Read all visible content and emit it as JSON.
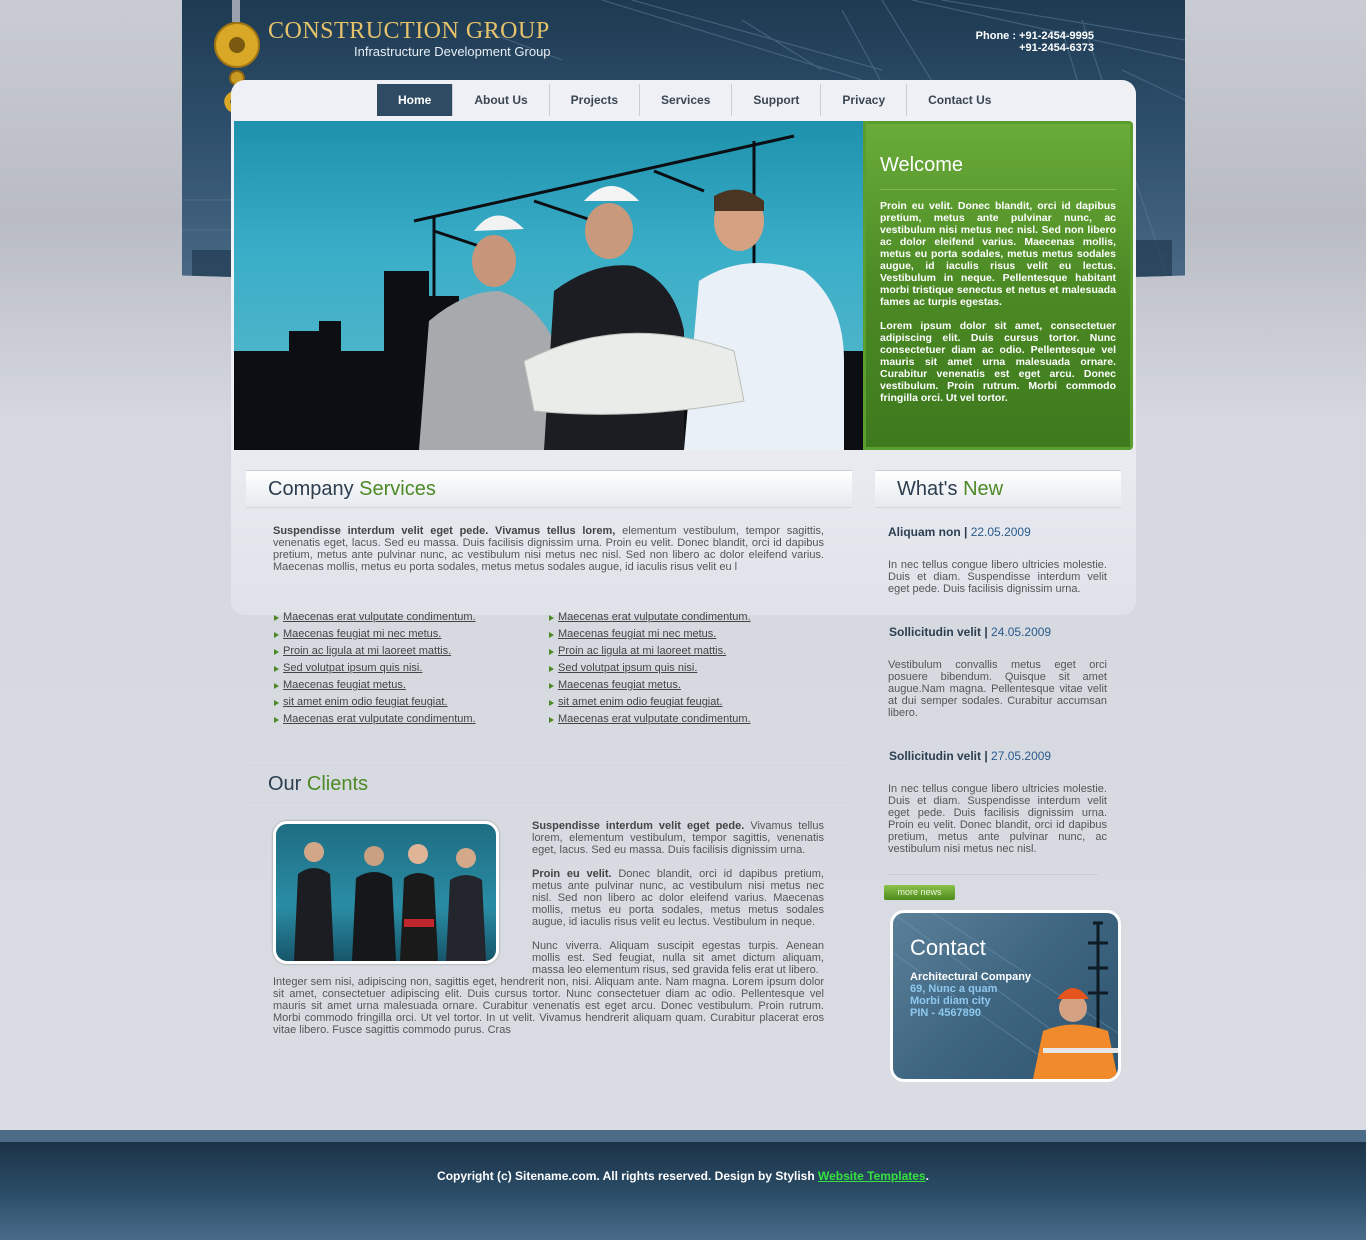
{
  "brand": {
    "title": "CONSTRUCTION GROUP",
    "subtitle": "Infrastructure Development Group"
  },
  "phone": {
    "line1": "Phone : +91-2454-9995",
    "line2": "+91-2454-6373"
  },
  "nav": {
    "items": [
      {
        "label": "Home",
        "active": true
      },
      {
        "label": "About Us"
      },
      {
        "label": "Projects"
      },
      {
        "label": "Services"
      },
      {
        "label": "Support"
      },
      {
        "label": "Privacy"
      },
      {
        "label": "Contact Us"
      }
    ]
  },
  "welcome": {
    "title": "Welcome",
    "p1": "Proin eu velit. Donec blandit, orci id dapibus pretium, metus ante pulvinar nunc, ac vestibulum nisi metus nec nisl. Sed non libero ac dolor eleifend varius. Maecenas mollis, metus eu porta sodales, metus metus sodales augue, id iaculis risus velit eu lectus. Vestibulum in neque. Pellentesque habitant morbi tristique senectus et netus et malesuada fames ac turpis egestas.",
    "p2": "Lorem ipsum dolor sit amet, consectetuer adipiscing elit. Duis cursus tortor. Nunc consectetuer diam ac odio. Pellentesque vel mauris sit amet urna malesuada ornare. Curabitur venenatis est eget arcu. Donec vestibulum. Proin rutrum. Morbi commodo fringilla orci. Ut vel tortor."
  },
  "services": {
    "heading_a": "Company ",
    "heading_b": "Services",
    "intro_bold": "Suspendisse interdum velit eget pede. Vivamus tellus lorem,",
    "intro_rest": " elementum vestibulum, tempor sagittis, venenatis eget, lacus. Sed eu massa. Duis facilisis dignissim urna. Proin eu velit. Donec blandit, orci id dapibus pretium, metus ante pulvinar nunc, ac vestibulum nisi metus nec nisl. Sed non libero ac dolor eleifend varius. Maecenas mollis, metus eu porta sodales, metus metus sodales augue, id iaculis risus velit eu l",
    "links_left": [
      "Maecenas erat vulputate condimentum.",
      "Maecenas feugiat mi nec metus.",
      "Proin ac ligula at mi laoreet mattis.",
      "Sed volutpat ipsum quis nisi.",
      "Maecenas feugiat metus.",
      "sit amet enim odio feugiat feugiat.",
      "Maecenas erat vulputate condimentum."
    ],
    "links_right": [
      "Maecenas erat vulputate condimentum.",
      "Maecenas feugiat mi nec metus.",
      "Proin ac ligula at mi laoreet mattis.",
      "Sed volutpat ipsum quis nisi.",
      "Maecenas feugiat metus.",
      "sit amet enim odio feugiat feugiat.",
      "Maecenas erat vulputate condimentum."
    ]
  },
  "clients": {
    "heading_a": "Our ",
    "heading_b": "Clients",
    "p1_bold": "Suspendisse interdum velit eget pede.",
    "p1_rest": " Vivamus tellus lorem, elementum vestibulum, tempor sagittis, venenatis eget, lacus. Sed eu massa. Duis facilisis dignissim urna.",
    "p2_bold": "Proin eu velit.",
    "p2_rest": " Donec blandit, orci id dapibus pretium, metus ante pulvinar nunc, ac vestibulum nisi metus nec nisl. Sed non libero ac dolor eleifend varius. Maecenas mollis, metus eu porta sodales, metus metus sodales augue, id iaculis risus velit eu lectus. Vestibulum in neque.",
    "p3a": "Nunc viverra. Aliquam suscipit egestas turpis. Aenean mollis est. Sed feugiat, nulla sit amet dictum aliquam, massa leo elementum risus, sed gravida felis erat ut libero.",
    "p3b": "Integer sem nisi, adipiscing non, sagittis eget, hendrerit non, nisi. Aliquam ante. Nam magna. Lorem ipsum dolor sit amet, consectetuer adipiscing elit. Duis cursus tortor. Nunc consectetuer diam ac odio. Pellentesque vel mauris sit amet urna malesuada ornare. Curabitur venenatis est eget arcu. Donec vestibulum. Proin rutrum. Morbi commodo fringilla orci. Ut vel tortor. In ut velit. Vivamus hendrerit aliquam quam. Curabitur placerat eros vitae libero. Fusce sagittis commodo purus. Cras"
  },
  "news": {
    "heading_a": "What's ",
    "heading_b": "New",
    "items": [
      {
        "title": "Aliquam non",
        "date": "22.05.2009",
        "body": "In nec tellus congue libero ultricies molestie. Duis et diam. Suspendisse interdum velit eget pede. Duis facilisis dignissim urna."
      },
      {
        "title": "Sollicitudin velit",
        "date": "24.05.2009",
        "body": "Vestibulum convallis metus eget orci posuere bibendum. Quisque sit amet augue.Nam magna. Pellentesque vitae velit at dui semper sodales. Curabitur accumsan libero."
      },
      {
        "title": "Sollicitudin velit",
        "date": "27.05.2009",
        "body": "In nec tellus congue libero ultricies molestie. Duis et diam. Suspendisse interdum velit eget pede. Duis facilisis dignissim urna. Proin eu velit. Donec blandit, orci id dapibus pretium, metus ante pulvinar nunc, ac vestibulum nisi metus nec nisl."
      }
    ],
    "more_label": "more news"
  },
  "contact": {
    "title": "Contact",
    "company": "Architectural Company",
    "line1": "69, Nunc a quam",
    "line2": "Morbi diam city",
    "line3": "PIN - 4567890"
  },
  "footer": {
    "text": "Copyright (c) Sitename.com. All rights reserved. Design by Stylish ",
    "link": "Website Templates",
    "end": "."
  },
  "colors": {
    "header_bg": "#1e3a52",
    "accent_green": "#4d8a25",
    "nav_active": "#2f4a63",
    "gold": "#e6c26a"
  }
}
